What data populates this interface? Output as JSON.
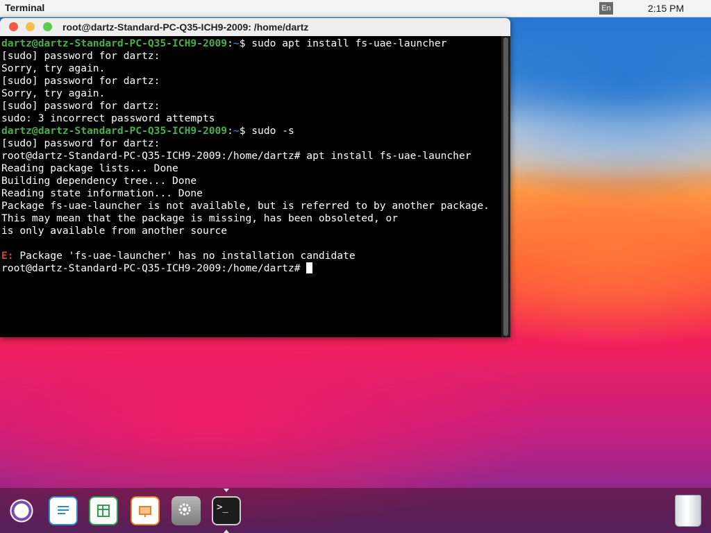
{
  "topbar": {
    "app_title": "Terminal",
    "lang": "En",
    "clock": "2:15 PM"
  },
  "terminal": {
    "title": "root@dartz-Standard-PC-Q35-ICH9-2009: /home/dartz",
    "lines": [
      {
        "user": "dartz@dartz-Standard-PC-Q35-ICH9-2009",
        "path": "~",
        "cmd": "$ sudo apt install fs-uae-launcher"
      },
      {
        "text": "[sudo] password for dartz:"
      },
      {
        "text": "Sorry, try again."
      },
      {
        "text": "[sudo] password for dartz:"
      },
      {
        "text": "Sorry, try again."
      },
      {
        "text": "[sudo] password for dartz:"
      },
      {
        "text": "sudo: 3 incorrect password attempts"
      },
      {
        "user": "dartz@dartz-Standard-PC-Q35-ICH9-2009",
        "path": "~",
        "cmd": "$ sudo -s"
      },
      {
        "text": "[sudo] password for dartz:"
      },
      {
        "text": "root@dartz-Standard-PC-Q35-ICH9-2009:/home/dartz# apt install fs-uae-launcher"
      },
      {
        "text": "Reading package lists... Done"
      },
      {
        "text": "Building dependency tree... Done"
      },
      {
        "text": "Reading state information... Done"
      },
      {
        "text": "Package fs-uae-launcher is not available, but is referred to by another package."
      },
      {
        "text": "This may mean that the package is missing, has been obsoleted, or"
      },
      {
        "text": "is only available from another source"
      },
      {
        "text": ""
      },
      {
        "err": "E:",
        "text": " Package 'fs-uae-launcher' has no installation candidate"
      },
      {
        "prompt": "root@dartz-Standard-PC-Q35-ICH9-2009:/home/dartz# "
      }
    ]
  },
  "dock": {
    "items": [
      "ubuntu-icon",
      "writer-icon",
      "calc-icon",
      "impress-icon",
      "settings-icon",
      "terminal-icon"
    ],
    "terminal_glyph": ">_",
    "trash": "trash-icon"
  }
}
